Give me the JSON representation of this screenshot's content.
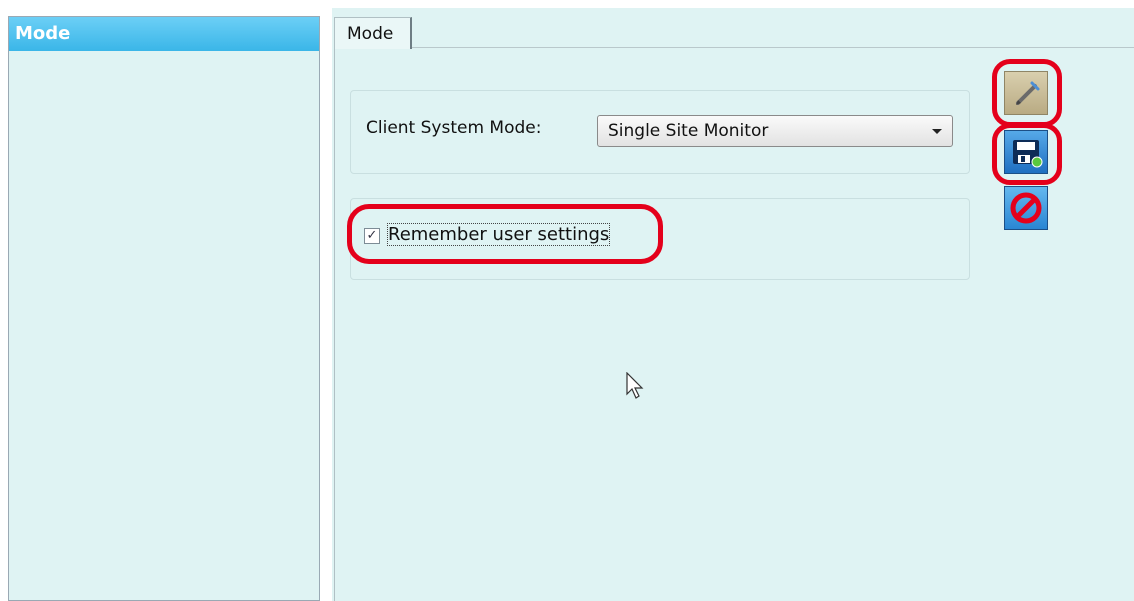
{
  "left_panel": {
    "header": "Mode"
  },
  "tabs": [
    {
      "label": "Mode"
    }
  ],
  "mode_group": {
    "label": "Client System Mode:",
    "dropdown_value": "Single Site Monitor"
  },
  "settings_group": {
    "checkbox_label": "Remember user settings",
    "checked": true
  },
  "toolbar": {
    "icons": [
      "edit-icon",
      "save-icon",
      "cancel-icon"
    ]
  },
  "colors": {
    "panel_background": "#dff3f3",
    "header_blue": "#3ab6e8",
    "highlight_red": "#e4001b"
  }
}
